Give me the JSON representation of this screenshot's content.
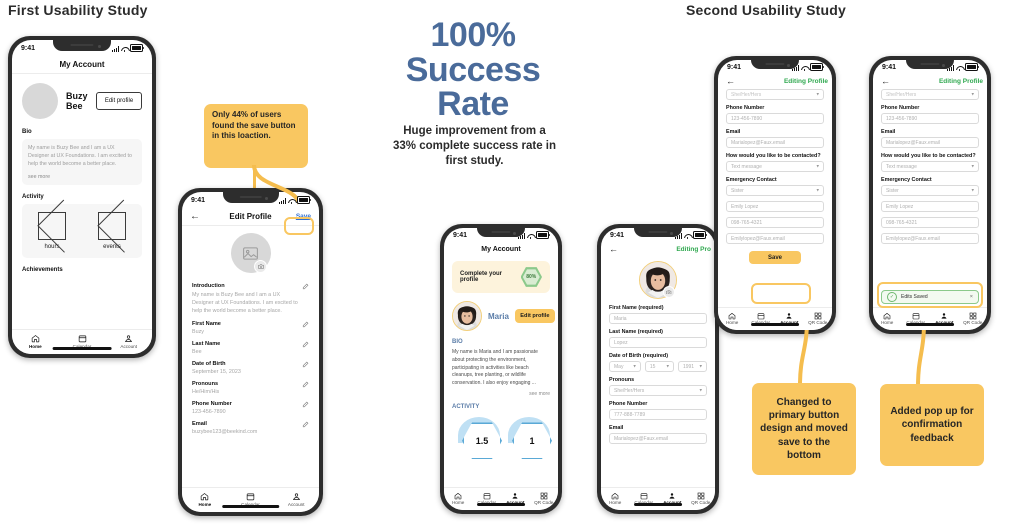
{
  "headings": {
    "first_study": "First Usability Study",
    "second_study": "Second Usability Study"
  },
  "center": {
    "stat_line1": "100%",
    "stat_line2": "Success",
    "stat_line3": "Rate",
    "stat_color": "#4a6b9a",
    "caption": "Huge improvement from a 33% complete success rate in first study."
  },
  "callouts": {
    "save_location": "Only 44% of users found the save button in this loaction.",
    "primary_button": "Changed to primary button design and moved save to the bottom",
    "popup": "Added pop up for confirmation feedback",
    "color": "#f9c761"
  },
  "phone1": {
    "status_time": "9:41",
    "title": "My Account",
    "user_name": "Buzy Bee",
    "edit_button": "Edit  profile",
    "bio_heading": "Bio",
    "bio_text": "My name is Buzy Bee and I am a UX Designer at UX Foundations. I am excited to help the world become a better place.",
    "see_more": "see more",
    "activity_heading": "Activity",
    "activity_items": [
      "hours",
      "events"
    ],
    "achievements_heading": "Achievements",
    "tabs": [
      {
        "label": "Home",
        "icon": "home-icon",
        "active": true
      },
      {
        "label": "Calendar",
        "icon": "calendar-icon",
        "active": false
      },
      {
        "label": "Account",
        "icon": "account-icon",
        "active": false
      }
    ]
  },
  "phone2": {
    "status_time": "9:41",
    "title": "Edit Profile",
    "save_label": "Save",
    "fields": [
      {
        "label": "Introduction",
        "value": "My name is Buzy Bee and I am a UX Designer at UX Foundations. I am excited to help the world become a better place."
      },
      {
        "label": "First Name",
        "value": "Buzy"
      },
      {
        "label": "Last Name",
        "value": "Bee"
      },
      {
        "label": "Date of Birth",
        "value": "September 15, 2023"
      },
      {
        "label": "Pronouns",
        "value": "He/Him/His"
      },
      {
        "label": "Phone Number",
        "value": "123-456-7890"
      },
      {
        "label": "Email",
        "value": "buzybee123@beekind.com"
      }
    ],
    "tabs": [
      {
        "label": "Home",
        "icon": "home-icon",
        "active": true
      },
      {
        "label": "Calendar",
        "icon": "calendar-icon",
        "active": false
      },
      {
        "label": "Account",
        "icon": "account-icon",
        "active": false
      }
    ]
  },
  "phone3": {
    "status_time": "9:41",
    "title": "My Account",
    "banner_text": "Complete your profile",
    "banner_percent": "80%",
    "user_name": "Maria",
    "edit_button": "Edit profile",
    "bio_heading": "BIO",
    "bio_text": "My name is Maria and I am passionate about protecting the environment, participating in activities like beach cleanups, tree planting, or wildlife conservation.  I also enjoy engaging ...",
    "see_more": "see more",
    "activity_heading": "ACTIVITY",
    "stats": [
      "1.5",
      "1"
    ],
    "tabs": [
      {
        "label": "Home",
        "icon": "home-icon",
        "active": false
      },
      {
        "label": "Calendar",
        "icon": "calendar-icon",
        "active": false
      },
      {
        "label": "Account",
        "icon": "account-icon",
        "active": true
      },
      {
        "label": "QR Code",
        "icon": "qrcode-icon",
        "active": false
      }
    ]
  },
  "phone4": {
    "status_time": "9:41",
    "title": "Editing Pro",
    "fields": [
      {
        "label": "First Name (required)",
        "value": "Maria",
        "type": "text"
      },
      {
        "label": "Last Name (required)",
        "value": "Lopez",
        "type": "text"
      },
      {
        "label": "Date of Birth (required)",
        "value": "",
        "type": "date"
      },
      {
        "label": "Pronouns",
        "value": "She/Her/Hers",
        "type": "select"
      },
      {
        "label": "Phone Number",
        "value": "777-888-7789",
        "type": "text"
      },
      {
        "label": "Email",
        "value": "Marialopez@Faux.email",
        "type": "text"
      }
    ],
    "dob": {
      "month": "May",
      "day": "15",
      "year": "1991"
    },
    "tabs": [
      {
        "label": "Home",
        "icon": "home-icon",
        "active": false
      },
      {
        "label": "Calendar",
        "icon": "calendar-icon",
        "active": false
      },
      {
        "label": "Account",
        "icon": "account-icon",
        "active": true
      },
      {
        "label": "QR Code",
        "icon": "qrcode-icon",
        "active": false
      }
    ]
  },
  "phone5": {
    "status_time": "9:41",
    "title": "Editing Profile",
    "partial_field_value": "She/Her/Hers",
    "fields": [
      {
        "label": "Phone Number",
        "value": "123-456-7890",
        "type": "text"
      },
      {
        "label": "Email",
        "value": "Marialopez@Faux.email",
        "type": "text"
      },
      {
        "label": "How would you like to be contacted?",
        "value": "Text message",
        "type": "select"
      },
      {
        "label": "Emergency Contact",
        "value": "Sister",
        "type": "select"
      }
    ],
    "emergency_rows": [
      "Emily Lopez",
      "098-765-4321",
      "Emilylopez@Faux.email"
    ],
    "save_label": "Save",
    "tabs": [
      {
        "label": "Home",
        "icon": "home-icon",
        "active": false
      },
      {
        "label": "Calendar",
        "icon": "calendar-icon",
        "active": false
      },
      {
        "label": "Account",
        "icon": "account-icon",
        "active": true
      },
      {
        "label": "QR Code",
        "icon": "qrcode-icon",
        "active": false
      }
    ]
  },
  "phone6": {
    "status_time": "9:41",
    "title": "Editing Profile",
    "partial_field_value": "She/Her/Hers",
    "fields": [
      {
        "label": "Phone Number",
        "value": "123-456-7890",
        "type": "text"
      },
      {
        "label": "Email",
        "value": "Marialopez@Faux.email",
        "type": "text"
      },
      {
        "label": "How would you like to be contacted?",
        "value": "Text message",
        "type": "select"
      },
      {
        "label": "Emergency Contact",
        "value": "Sister",
        "type": "select"
      }
    ],
    "emergency_rows": [
      "Emily Lopez",
      "098-765-4321",
      "Emilylopez@Faux.email"
    ],
    "toast_text": "Edits Saved",
    "toast_close": "×",
    "tabs": [
      {
        "label": "Home",
        "icon": "home-icon",
        "active": false
      },
      {
        "label": "Calendar",
        "icon": "calendar-icon",
        "active": false
      },
      {
        "label": "Account",
        "icon": "account-icon",
        "active": true
      },
      {
        "label": "QR Code",
        "icon": "qrcode-icon",
        "active": false
      }
    ]
  }
}
